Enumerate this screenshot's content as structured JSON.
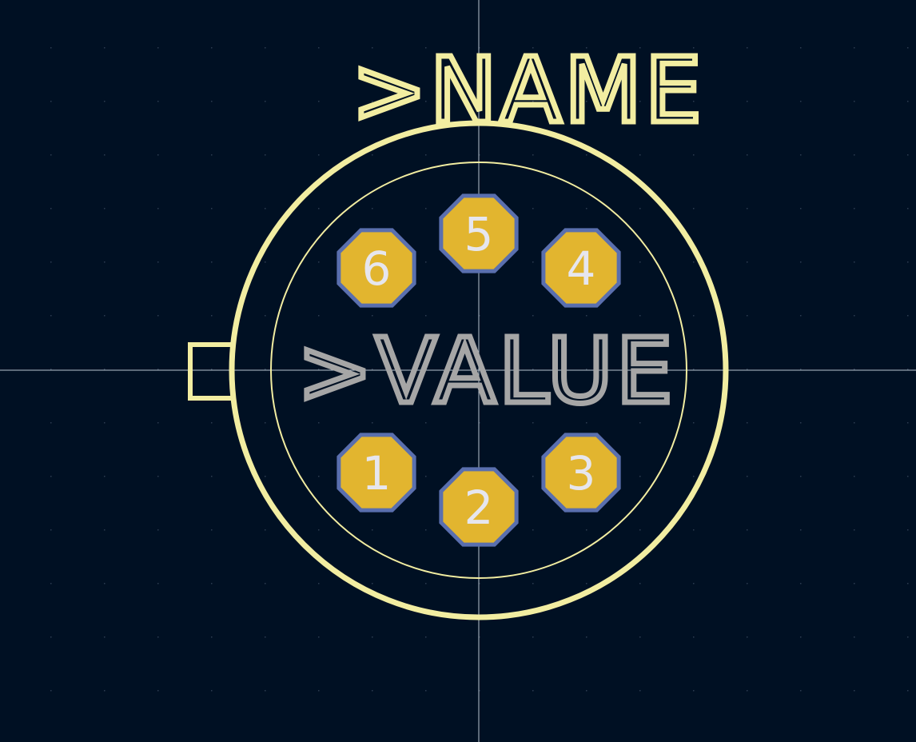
{
  "colors": {
    "background": "#001023",
    "grid_dot": "#2c3b50",
    "crosshair": "#b9c4cf",
    "silkscreen": "#f2eda1",
    "value_text": "#a6a6a6",
    "pad_copper": "#e2b52f",
    "pad_outline": "#5a6fae",
    "pad_number": "#e6e6ee"
  },
  "footprint": {
    "name_label": ">NAME",
    "value_label": ">VALUE",
    "pads": [
      {
        "number": "1"
      },
      {
        "number": "2"
      },
      {
        "number": "3"
      },
      {
        "number": "4"
      },
      {
        "number": "5"
      },
      {
        "number": "6"
      }
    ]
  }
}
